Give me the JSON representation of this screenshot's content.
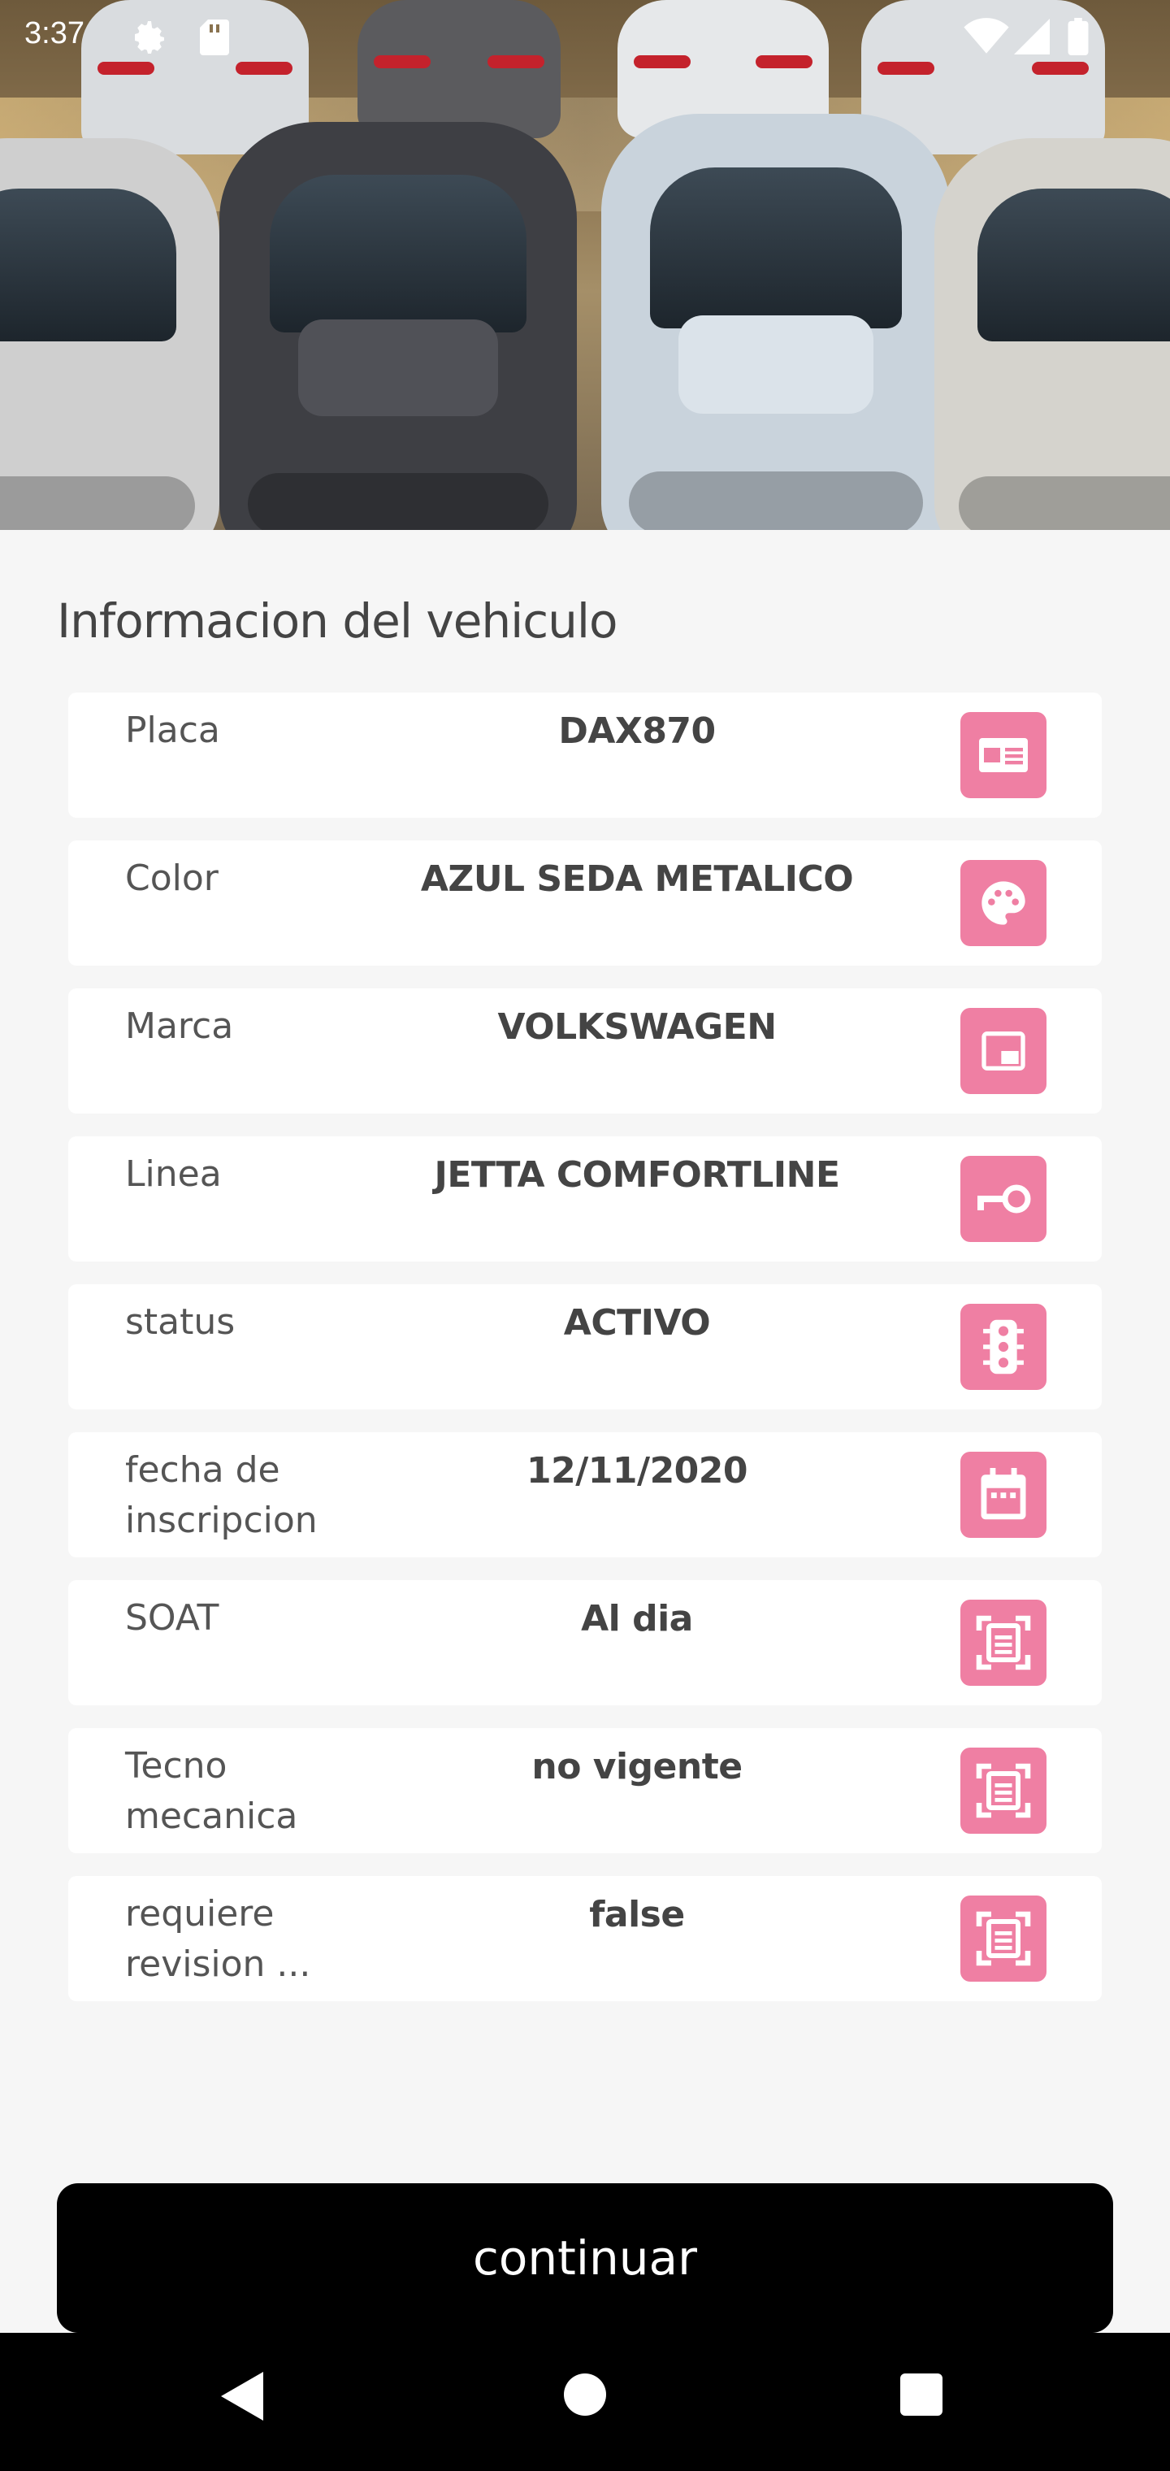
{
  "status_bar": {
    "time": "3:37"
  },
  "page": {
    "title": "Informacion del vehiculo"
  },
  "rows": [
    {
      "label": "Placa",
      "value": "DAX870",
      "icon": "id-card-icon"
    },
    {
      "label": "Color",
      "value": "AZUL SEDA METALICO",
      "icon": "palette-icon"
    },
    {
      "label": "Marca",
      "value": "VOLKSWAGEN",
      "icon": "picture-in-picture-icon"
    },
    {
      "label": "Linea",
      "value": "JETTA COMFORTLINE",
      "icon": "key-icon"
    },
    {
      "label": "status",
      "value": "ACTIVO",
      "icon": "traffic-light-icon"
    },
    {
      "label": "fecha de inscripcion",
      "value": "12/11/2020",
      "icon": "calendar-icon"
    },
    {
      "label": "SOAT",
      "value": "Al dia",
      "icon": "document-scan-icon"
    },
    {
      "label": "Tecno mecanica",
      "value": "no vigente",
      "icon": "document-scan-icon"
    },
    {
      "label": "requiere revision ...",
      "value": "false",
      "icon": "document-scan-icon"
    }
  ],
  "continue_button": {
    "label": "continuar"
  },
  "colors": {
    "icon_bg": "#ef7fa3",
    "button_bg": "#000000",
    "page_bg": "#f6f6f6"
  }
}
